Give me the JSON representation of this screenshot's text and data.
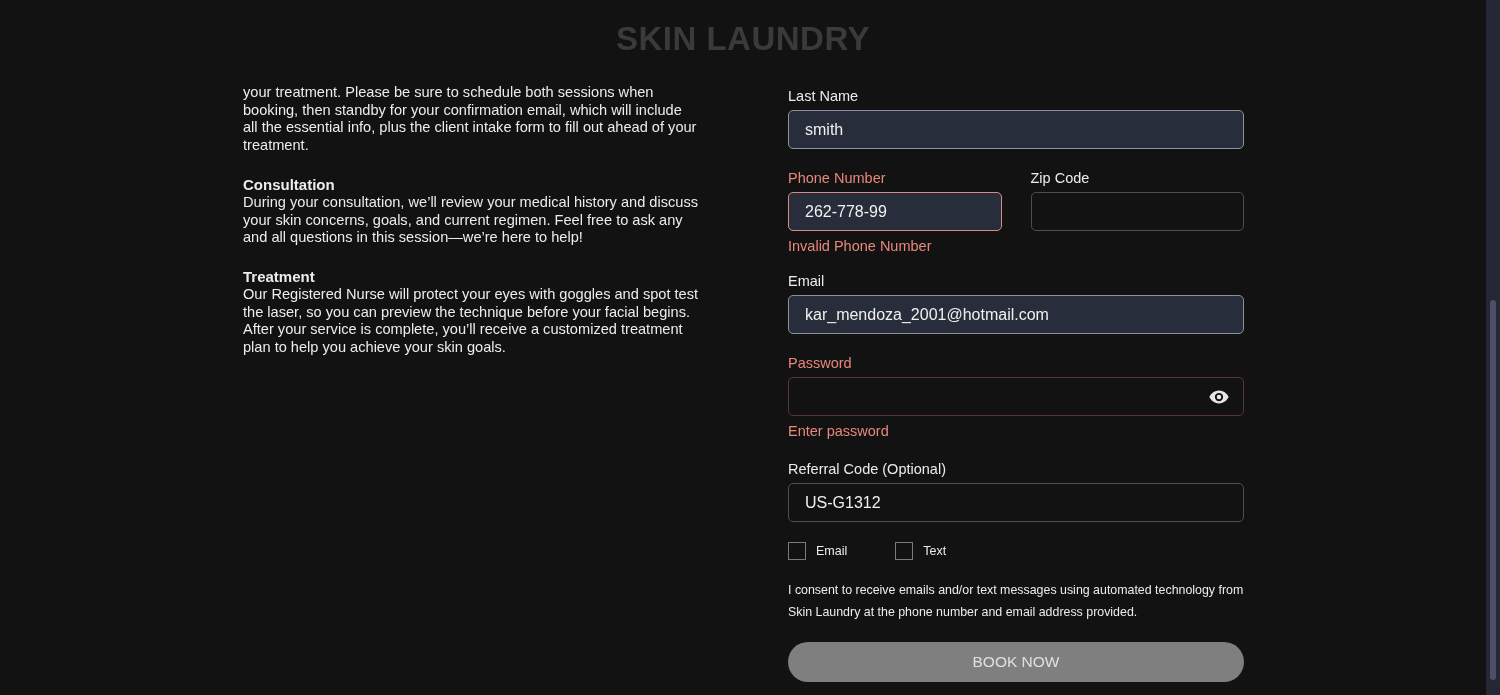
{
  "header": {
    "logo": "SKIN LAUNDRY"
  },
  "intro": {
    "paragraph": "your treatment. Please be sure to schedule both sessions when booking, then standby for your confirmation email, which will include all the essential info, plus the client intake form to fill out ahead of your treatment."
  },
  "sections": [
    {
      "heading": "Consultation",
      "body": "During your consultation, we’ll review your medical history and discuss your skin concerns, goals, and current regimen. Feel free to ask any and all questions in this session—we’re here to help!"
    },
    {
      "heading": "Treatment",
      "body": "Our Registered Nurse will protect your eyes with goggles and spot test the laser, so you can preview the technique before your facial begins. After your service is complete, you’ll receive a customized treatment plan to help you achieve your skin goals."
    }
  ],
  "form": {
    "rows": [
      {
        "fields": [
          {
            "label": "Last Name",
            "kind": "text",
            "value": "smith",
            "autofilled": true,
            "invalid": false
          }
        ]
      },
      {
        "fields": [
          {
            "label": "Phone Number",
            "kind": "text",
            "value": "262-778-99",
            "autofilled": true,
            "invalid": true,
            "error": "Invalid Phone Number"
          },
          {
            "label": "Zip Code",
            "kind": "text",
            "autofilled": false,
            "invalid": false
          }
        ]
      },
      {
        "fields": [
          {
            "label": "Email",
            "kind": "text",
            "value": "kar_mendoza_2001@hotmail.com",
            "autofilled": true,
            "invalid": false
          }
        ]
      },
      {
        "fields": [
          {
            "label": "Password",
            "kind": "password",
            "autofilled": false,
            "invalid": true,
            "error": "Enter password"
          }
        ]
      },
      {
        "fields": [
          {
            "label": "Referral Code (Optional)",
            "kind": "text",
            "value": "US-G1312",
            "autofilled": false,
            "invalid": false
          }
        ]
      }
    ],
    "checkboxes": [
      {
        "label": "Email",
        "checked": false
      },
      {
        "label": "Text",
        "checked": false
      }
    ],
    "consent": "I consent to receive emails and/or text messages using automated technology from Skin Laundry at the phone number and email address provided.",
    "submit": {
      "label": "BOOK NOW",
      "disabled": true
    }
  }
}
